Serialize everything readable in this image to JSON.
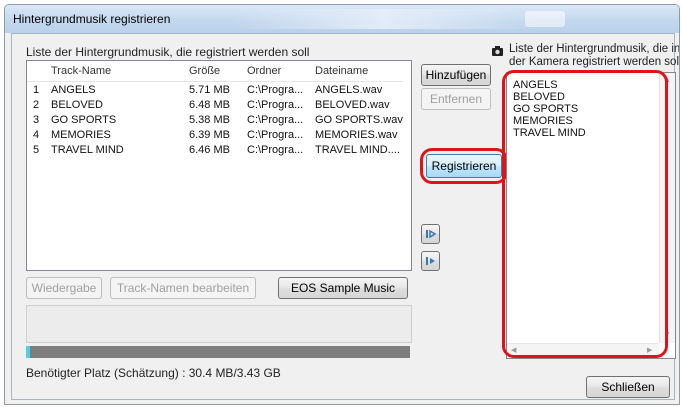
{
  "window": {
    "title": "Hintergrundmusik registrieren"
  },
  "left": {
    "heading": "Liste der Hintergrundmusik, die registriert werden soll",
    "columns": [
      "Track-Name",
      "Größe",
      "Ordner",
      "Dateiname"
    ],
    "rows": [
      [
        "1",
        "ANGELS",
        "5.71 MB",
        "C:\\Progra...",
        "ANGELS.wav"
      ],
      [
        "2",
        "BELOVED",
        "6.48 MB",
        "C:\\Progra...",
        "BELOVED.wav"
      ],
      [
        "3",
        "GO SPORTS",
        "5.38 MB",
        "C:\\Progra...",
        "GO SPORTS.wav"
      ],
      [
        "4",
        "MEMORIES",
        "6.39 MB",
        "C:\\Progra...",
        "MEMORIES.wav"
      ],
      [
        "5",
        "TRAVEL MIND",
        "6.46 MB",
        "C:\\Progra...",
        "TRAVEL MIND...."
      ]
    ],
    "buttons": {
      "play": "Wiedergabe",
      "rename": "Track-Namen bearbeiten",
      "sample": "EOS Sample Music"
    },
    "space_label": "Benötigter Platz (Schätzung) : 30.4 MB/3.43 GB"
  },
  "middle": {
    "add": "Hinzufügen",
    "remove": "Entfernen",
    "register": "Registrieren"
  },
  "right": {
    "heading_line1": "Liste der Hintergrundmusik, die in",
    "heading_line2": "der Kamera registriert werden soll",
    "items": [
      "ANGELS",
      "BELOVED",
      "GO SPORTS",
      "MEMORIES",
      "TRAVEL MIND"
    ],
    "close": "Schließen"
  },
  "colors": {
    "highlight": "#e01418",
    "progress_fill": "#4fd0e8",
    "progress_bg": "#7d7d7d"
  }
}
